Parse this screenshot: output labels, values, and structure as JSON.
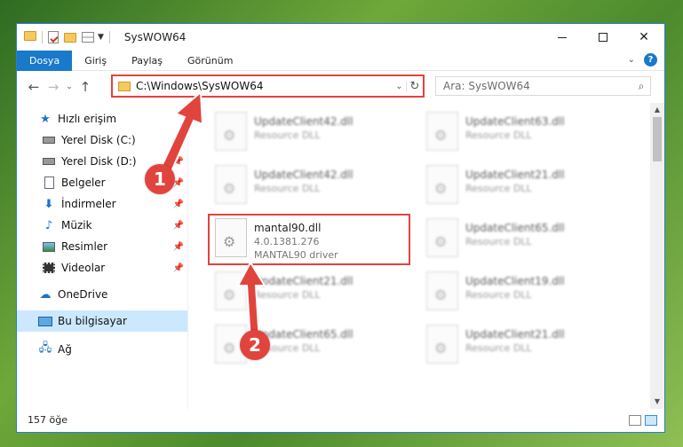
{
  "window": {
    "title": "SysWOW64"
  },
  "ribbon": {
    "tabs": [
      "Dosya",
      "Giriş",
      "Paylaş",
      "Görünüm"
    ]
  },
  "address": {
    "path": "C:\\Windows\\SysWOW64",
    "search_placeholder": "Ara: SysWOW64"
  },
  "sidebar": {
    "items": [
      {
        "label": "Hızlı erişim",
        "icon": "star-icon"
      },
      {
        "label": "Yerel Disk (C:)",
        "icon": "disk-icon"
      },
      {
        "label": "Yerel Disk (D:)",
        "icon": "disk-icon"
      },
      {
        "label": "Belgeler",
        "icon": "document-icon"
      },
      {
        "label": "İndirmeler",
        "icon": "download-icon"
      },
      {
        "label": "Müzik",
        "icon": "music-icon"
      },
      {
        "label": "Resimler",
        "icon": "pictures-icon"
      },
      {
        "label": "Videolar",
        "icon": "video-icon"
      },
      {
        "label": "OneDrive",
        "icon": "cloud-icon"
      },
      {
        "label": "Bu bilgisayar",
        "icon": "computer-icon"
      },
      {
        "label": "Ağ",
        "icon": "network-icon"
      }
    ]
  },
  "files": [
    {
      "name": "UpdateClient42.dll",
      "sub1": "Resource DLL",
      "sub2": ""
    },
    {
      "name": "UpdateClient63.dll",
      "sub1": "Resource DLL",
      "sub2": ""
    },
    {
      "name": "UpdateClient42.dll",
      "sub1": "Resource DLL",
      "sub2": ""
    },
    {
      "name": "UpdateClient21.dll",
      "sub1": "Resource DLL",
      "sub2": ""
    },
    {
      "name": "mantal90.dll",
      "sub1": "4.0.1381.276",
      "sub2": "MANTAL90 driver"
    },
    {
      "name": "UpdateClient65.dll",
      "sub1": "Resource DLL",
      "sub2": ""
    },
    {
      "name": "UpdateClient21.dll",
      "sub1": "Resource DLL",
      "sub2": ""
    },
    {
      "name": "UpdateClient19.dll",
      "sub1": "Resource DLL",
      "sub2": ""
    },
    {
      "name": "UpdateClient65.dll",
      "sub1": "Resource DLL",
      "sub2": ""
    },
    {
      "name": "UpdateClient21.dll",
      "sub1": "Resource DLL",
      "sub2": ""
    }
  ],
  "status": {
    "count": "157 öğe"
  },
  "annotations": {
    "step1": "1",
    "step2": "2",
    "color": "#e1443c"
  },
  "colors": {
    "accent": "#1979ca",
    "selection": "#cce8ff"
  }
}
